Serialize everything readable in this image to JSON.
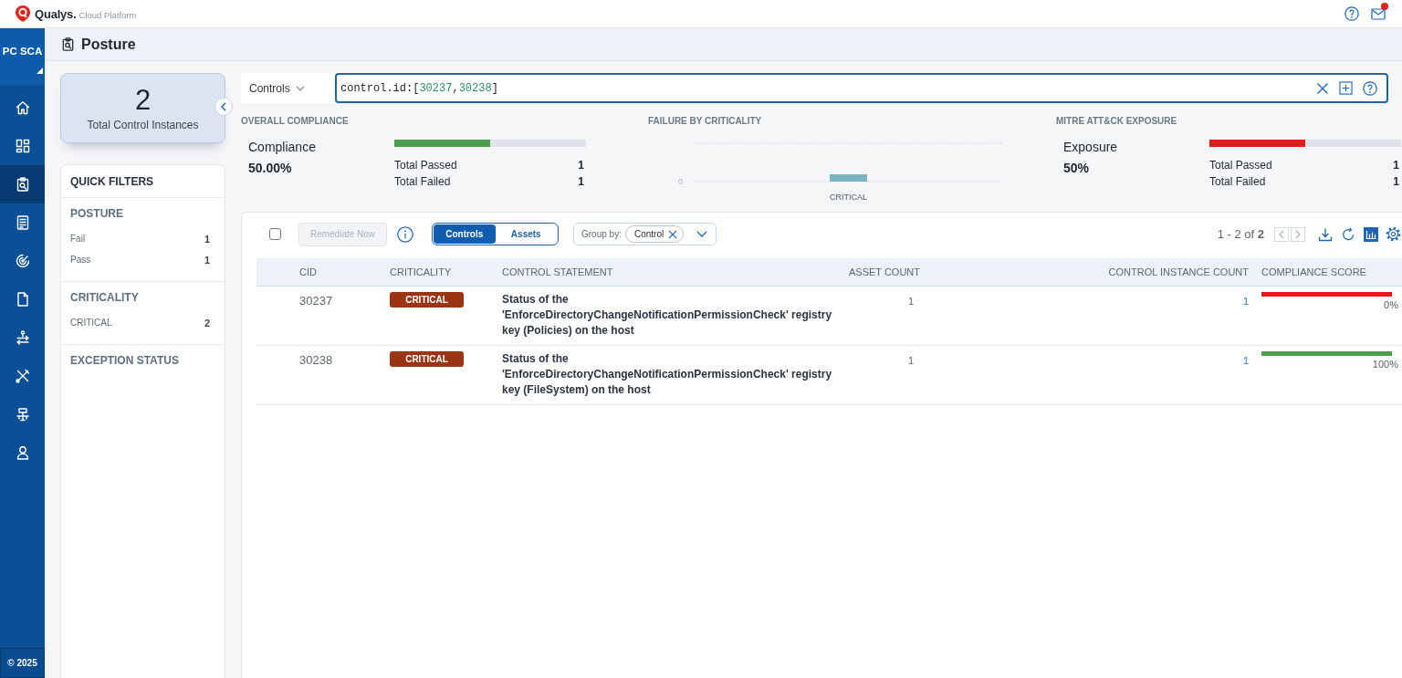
{
  "topbar": {
    "brand": "Qualys.",
    "product": "Cloud Platform",
    "unread": true
  },
  "nav": {
    "app": "PC SCA",
    "items": [
      {
        "kind": "home",
        "selected": false
      },
      {
        "kind": "grid",
        "selected": false
      },
      {
        "kind": "clipboard",
        "selected": true
      },
      {
        "kind": "checklist",
        "selected": false
      },
      {
        "kind": "radar",
        "selected": false
      },
      {
        "kind": "file",
        "selected": false
      },
      {
        "kind": "connector",
        "selected": false
      },
      {
        "kind": "tools",
        "selected": false
      },
      {
        "kind": "network",
        "selected": false
      },
      {
        "kind": "user",
        "selected": false
      }
    ],
    "footer": "© 2025"
  },
  "page": {
    "title": "Posture"
  },
  "summary": {
    "count": "2",
    "label": "Total Control Instances"
  },
  "quick_filters": {
    "title": "QUICK FILTERS",
    "groups": [
      {
        "title": "POSTURE",
        "items": [
          {
            "label": "Fail",
            "count": "1"
          },
          {
            "label": "Pass",
            "count": "1"
          }
        ]
      },
      {
        "title": "CRITICALITY",
        "items": [
          {
            "label": "CRITICAL",
            "count": "2"
          }
        ]
      },
      {
        "title": "EXCEPTION STATUS"
      }
    ]
  },
  "search": {
    "scope": "Controls",
    "query": [
      {
        "kind": "text",
        "text": "control.id:["
      },
      {
        "kind": "number",
        "text": "30237"
      },
      {
        "kind": "text",
        "text": ","
      },
      {
        "kind": "number",
        "text": "30238"
      },
      {
        "kind": "text",
        "text": "]"
      }
    ]
  },
  "stats": [
    {
      "kind": "meter",
      "heading": "OVERALL COMPLIANCE",
      "title": "Compliance",
      "value": "50.00%",
      "level": 0.5,
      "color": "#4c9f4c",
      "rows": [
        {
          "label": "Total Passed",
          "value": "1"
        },
        {
          "label": "Total Failed",
          "value": "1"
        }
      ]
    },
    {
      "kind": "chart",
      "heading": "FAILURE BY CRITICALITY",
      "axis_tick": "0",
      "category": "CRITICAL"
    },
    {
      "kind": "meter",
      "heading": "MITRE ATT&CK EXPOSURE",
      "title": "Exposure",
      "value": "50%",
      "level": 0.5,
      "color": "#e01b1b",
      "rows": [
        {
          "label": "Total Passed",
          "value": "1"
        },
        {
          "label": "Total Failed",
          "value": "1"
        }
      ]
    }
  ],
  "table": {
    "toolbar": {
      "select_all": {
        "checked": false
      },
      "remediate": {
        "label": "Remediate Now",
        "disabled": true
      },
      "views": [
        {
          "label": "Controls",
          "selected": true
        },
        {
          "label": "Assets",
          "selected": false
        }
      ],
      "group_by": {
        "label": "Group by:",
        "chip": "Control"
      },
      "pagination": "1 - 2 of **2**",
      "pager": [
        {
          "kind": "prev",
          "disabled": true
        },
        {
          "kind": "next",
          "disabled": true
        }
      ]
    },
    "columns": [
      "CID",
      "CRITICALITY",
      "CONTROL STATEMENT",
      "ASSET COUNT",
      "CONTROL INSTANCE COUNT",
      "COMPLIANCE SCORE"
    ],
    "rows": [
      {
        "cid": "30237",
        "criticality": "CRITICAL",
        "statement": "Status of the 'EnforceDirectoryChangeNotificationPermissionCheck' registry key (Policies) on the host",
        "asset_count": "1",
        "instance_count": "1",
        "score": "0%",
        "passed": false
      },
      {
        "cid": "30238",
        "criticality": "CRITICAL",
        "statement": "Status of the 'EnforceDirectoryChangeNotificationPermissionCheck' registry key (FileSystem) on the host",
        "asset_count": "1",
        "instance_count": "1",
        "score": "100%",
        "passed": true
      }
    ]
  }
}
